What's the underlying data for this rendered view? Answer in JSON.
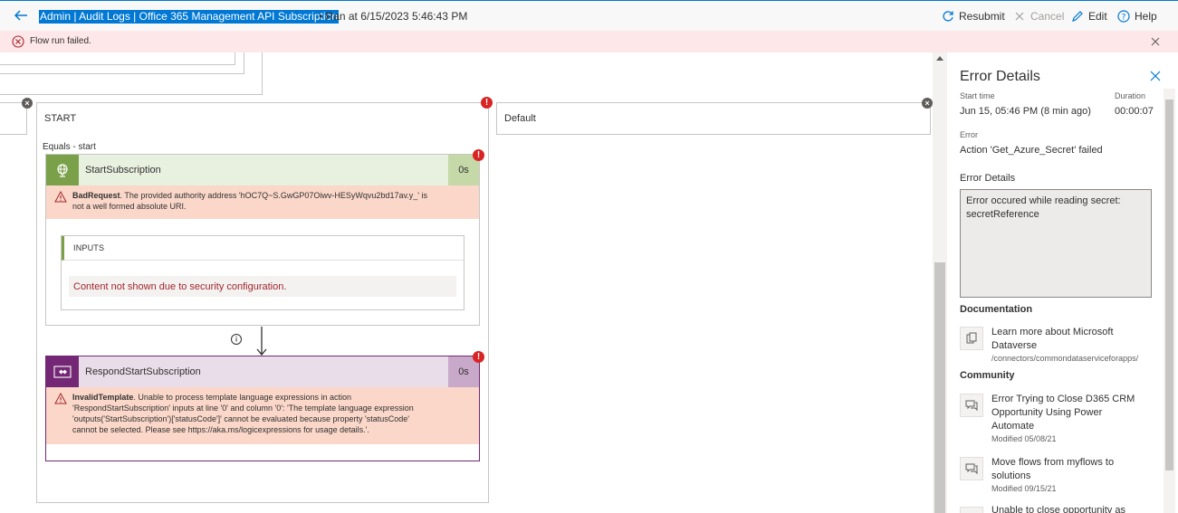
{
  "header": {
    "title": "Admin | Audit Logs | Office 365 Management API Subscription",
    "ran_at": "• Ran at 6/15/2023 5:46:43 PM",
    "resubmit": "Resubmit",
    "cancel": "Cancel",
    "edit": "Edit",
    "help": "Help"
  },
  "banner": {
    "message": "Flow run failed."
  },
  "canvas": {
    "start_case": "START",
    "default_case": "Default",
    "equals_label": "Equals - start",
    "action1": {
      "name": "StartSubscription",
      "duration": "0s",
      "error_code": "BadRequest",
      "error_line1": ". The provided authority address 'hOC7Q~S.GwGP07Oiwv-HESyWqvu2bd17av.y_' is",
      "error_line2": "not a well formed absolute URI.",
      "inputs_label": "INPUTS",
      "secure_message": "Content not shown due to security configuration."
    },
    "action2": {
      "name": "RespondStartSubscription",
      "duration": "0s",
      "error_code": "InvalidTemplate",
      "error_line1": ". Unable to process template language expressions in action",
      "error_line2": "'RespondStartSubscription' inputs at line '0' and column '0': 'The template language expression",
      "error_line3": "'outputs('StartSubscription')['statusCode']' cannot be evaluated because property 'statusCode'",
      "error_line4": "cannot be selected. Please see https://aka.ms/logicexpressions for usage details.'."
    }
  },
  "panel": {
    "title": "Error Details",
    "start_time_label": "Start time",
    "start_time_value": "Jun 15, 05:46 PM (8 min ago)",
    "duration_label": "Duration",
    "duration_value": "00:00:07",
    "error_label": "Error",
    "error_value": "Action 'Get_Azure_Secret' failed",
    "details_label": "Error Details",
    "details_text": "Error occured while reading secret: secretReference",
    "documentation_label": "Documentation",
    "doc_link": "Learn more about Microsoft Dataverse",
    "doc_path": "/connectors/commondataserviceforapps/",
    "community_label": "Community",
    "community": [
      {
        "title": "Error Trying to Close D365 CRM Opportunity Using Power Automate",
        "modified": "Modified 05/08/21"
      },
      {
        "title": "Move flows from myflows to solutions",
        "modified": "Modified 09/15/21"
      },
      {
        "title": "Unable to close opportunity as",
        "modified": ""
      }
    ]
  },
  "colors": {
    "accent": "#0078d4",
    "error_banner": "#fde7e9",
    "error_block": "#fad7c9",
    "action1_header": "#e8f0df",
    "action1_icon": "#7aa14a",
    "action2_header": "#e9dde9",
    "action2_icon": "#742774"
  }
}
